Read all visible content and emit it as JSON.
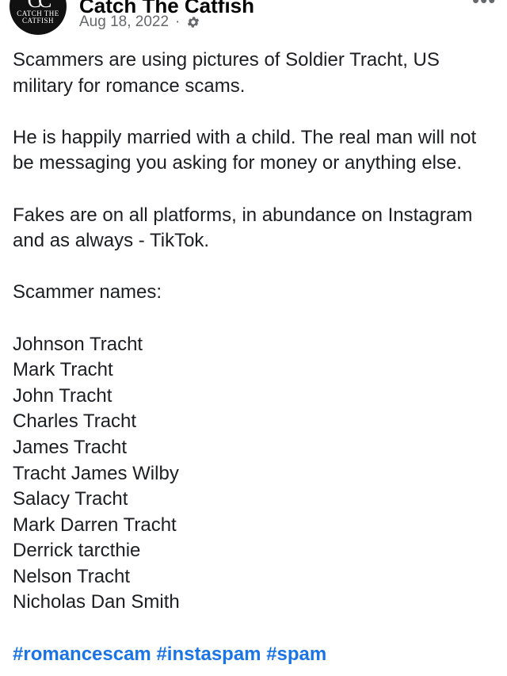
{
  "header": {
    "page_name": "Catch The Catfish",
    "avatar_mark": "CC",
    "avatar_text": "CATCH THE CATFISH",
    "date": "Aug 18, 2022",
    "separator": "·",
    "audience_icon": "gear-icon",
    "more_icon": "more-options-icon"
  },
  "post": {
    "paragraph1": "Scammers are using pictures of Soldier Tracht, US military for romance scams.",
    "paragraph2": "He is happily married with a child. The real man will not be messaging you asking for money or anything else.",
    "paragraph3": "Fakes are on all platforms, in abundance on Instagram and as always - TikTok.",
    "names_heading": "Scammer names:",
    "names": [
      "Johnson Tracht",
      "Mark Tracht",
      "John Tracht",
      "Charles Tracht",
      "James Tracht",
      "Tracht James Wilby",
      "Salacy Tracht",
      "Mark Darren Tracht",
      "Derrick tarcthie",
      "Nelson Tracht",
      "Nicholas Dan Smith"
    ],
    "hashtags": [
      "#romancescam",
      "#instaspam",
      "#spam"
    ]
  },
  "colors": {
    "text": "#1c1e21",
    "meta": "#65676b",
    "hashtag": "#1b74e4"
  }
}
